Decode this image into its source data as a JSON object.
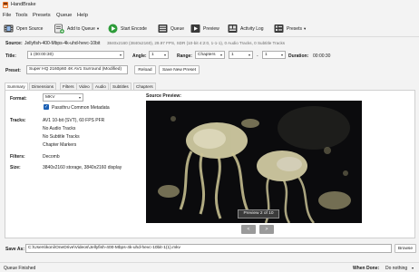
{
  "window": {
    "title": "HandBrake"
  },
  "menu": [
    "File",
    "Tools",
    "Presets",
    "Queue",
    "Help"
  ],
  "toolbar": {
    "open_source": "Open Source",
    "add_to_queue": "Add to Queue",
    "start_encode": "Start Encode",
    "queue": "Queue",
    "preview": "Preview",
    "activity_log": "Activity Log",
    "presets": "Presets"
  },
  "source": {
    "label": "Source:",
    "filename": "Jellyfish-400-Mbps-4k-uhd-hevc-10bit",
    "details": "3840x2160 (3840x2160), 29.97 FPS, SDR (10-bit 4:2:0, 1-1-1), 0 Audio Tracks, 0 Subtitle Tracks"
  },
  "title_row": {
    "title_label": "Title:",
    "title_value": "1 (00:00:30)",
    "angle_label": "Angle:",
    "angle_value": "1",
    "range_label": "Range:",
    "range_type": "Chapters",
    "range_start": "1",
    "range_sep": "-",
    "range_end": "1",
    "duration_label": "Duration:",
    "duration_value": "00:00:30"
  },
  "preset": {
    "label": "Preset:",
    "value": "Super HQ 2160p60 4K AV1 Surround  (Modified)",
    "reload": "Reload",
    "save_new": "Save New Preset"
  },
  "tabs": [
    "Summary",
    "Dimensions",
    "Filters",
    "Video",
    "Audio",
    "Subtitles",
    "Chapters"
  ],
  "summary": {
    "format_label": "Format:",
    "format_value": "MKV",
    "passthru_label": "Passthru Common Metadata",
    "passthru_checked": true,
    "tracks_label": "Tracks:",
    "tracks": [
      "AV1 10-bit (SVT), 60 FPS PFR",
      "No Audio Tracks",
      "No Subtitle Tracks",
      "Chapter Markers"
    ],
    "filters_label": "Filters:",
    "filters_value": "Decomb",
    "size_label": "Size:",
    "size_value": "3840x2160 storage, 3840x2160 display",
    "preview_label": "Source Preview:",
    "preview_caption": "Preview 2 of 10",
    "prev_btn": "<",
    "next_btn": ">"
  },
  "save_as": {
    "label": "Save As:",
    "path": "C:\\Users\\koni\\OneDrive\\Videos\\Jellyfish-400-Mbps-4k-uhd-hevc-10bit-1(1).mkv",
    "browse": "Browse"
  },
  "status": {
    "text": "Queue Finished",
    "when_done_label": "When Done:",
    "when_done_value": "Do nothing"
  },
  "colors": {
    "accent": "#1a5fb4",
    "start_green": "#2e9c3a"
  }
}
